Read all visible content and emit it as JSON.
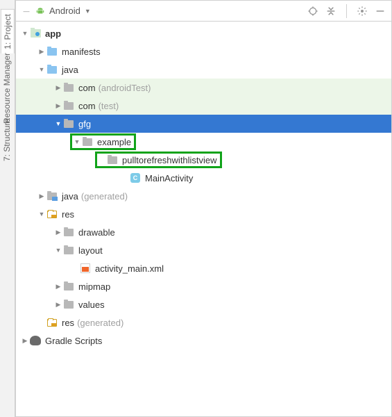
{
  "toolbar": {
    "dropdown_label": "Android"
  },
  "sidebar": {
    "tabs": [
      "1: Project",
      "Resource Manager",
      "7: Structure"
    ]
  },
  "tree": {
    "app": "app",
    "manifests": "manifests",
    "java": "java",
    "com_androidTest": "com",
    "com_androidTest_suffix": "(androidTest)",
    "com_test": "com",
    "com_test_suffix": "(test)",
    "gfg": "gfg",
    "example": "example",
    "pulltorefresh": "pulltorefreshwithlistview",
    "mainactivity": "MainActivity",
    "mainactivity_letter": "C",
    "java_gen": "java",
    "java_gen_suffix": "(generated)",
    "res": "res",
    "drawable": "drawable",
    "layout": "layout",
    "activity_main": "activity_main.xml",
    "mipmap": "mipmap",
    "values": "values",
    "res_gen": "res",
    "res_gen_suffix": "(generated)",
    "gradle": "Gradle Scripts"
  }
}
